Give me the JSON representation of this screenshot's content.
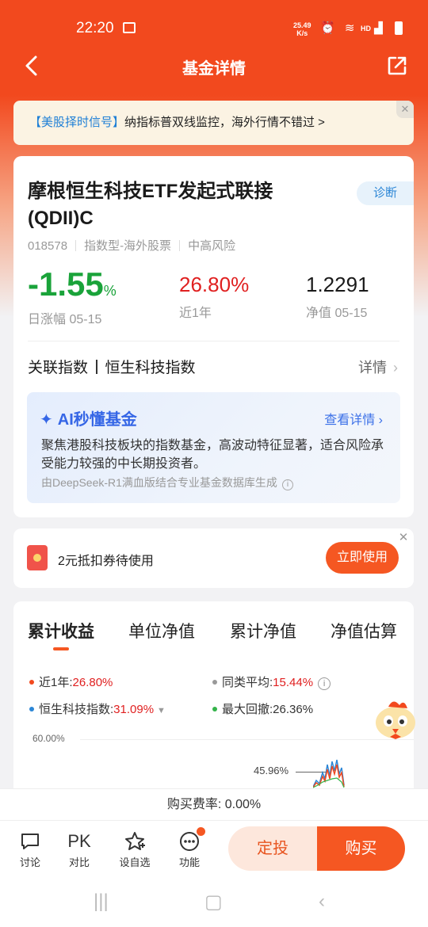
{
  "status_bar": {
    "time": "22:20",
    "net_speed": "25.49",
    "net_unit": "K/s",
    "hd": "HD",
    "signal": "4G"
  },
  "nav": {
    "title": "基金详情"
  },
  "banner": {
    "tag": "【美股择时信号】",
    "text": "纳指标普双线监控，海外行情不错过 >"
  },
  "fund": {
    "name": "摩根恒生科技ETF发起式联接(QDII)C",
    "diagnose": "诊断",
    "code": "018578",
    "type": "指数型-海外股票",
    "risk": "中高风险",
    "daily_change": "-1.55",
    "daily_change_unit": "%",
    "daily_change_label": "日涨幅 05-15",
    "year_return": "26.80%",
    "year_return_label": "近1年",
    "nav_value": "1.2291",
    "nav_label": "净值 05-15",
    "related_label": "关联指数",
    "related_index": "恒生科技指数",
    "detail_link": "详情"
  },
  "ai": {
    "title": "AI秒懂基金",
    "more": "查看详情",
    "desc": "聚焦港股科技板块的指数基金，高波动特征显著，适合风险承受能力较强的中长期投资者。",
    "footer": "由DeepSeek-R1满血版结合专业基金数据库生成"
  },
  "coupon": {
    "text": "2元抵扣券待使用",
    "button": "立即使用"
  },
  "chart": {
    "tabs": [
      "累计收益",
      "单位净值",
      "累计净值",
      "净值估算"
    ],
    "legend": {
      "year_label": "近1年:",
      "year_value": "26.80%",
      "peer_label": "同类平均:",
      "peer_value": "15.44%",
      "index_label": "恒生科技指数:",
      "index_value": "31.09%",
      "drawdown_label": "最大回撤:",
      "drawdown_value": "26.36%"
    },
    "ytick_top": "60.00%",
    "marker": "45.96%"
  },
  "fee": {
    "label": "购买费率:",
    "value": "0.00%"
  },
  "bottom": {
    "items": [
      {
        "label": "讨论"
      },
      {
        "label": "对比",
        "icon_text": "PK"
      },
      {
        "label": "设自选"
      },
      {
        "label": "功能"
      }
    ],
    "dingtou": "定投",
    "buy": "购买"
  },
  "colors": {
    "brand": "#f2491e",
    "up": "#e02020",
    "down": "#1aa33a",
    "accent_blue": "#3566e6"
  }
}
